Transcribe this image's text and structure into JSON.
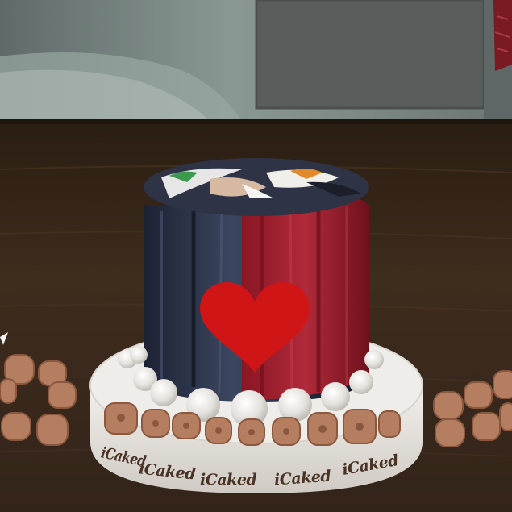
{
  "scene": {
    "subject": "virtual-world-cake",
    "brand_text": "iCaked",
    "brand_repeats": [
      "iCaked",
      "iCaked",
      "iCaked",
      "iCaked",
      "iCaked"
    ],
    "colors": {
      "wall": "#7d8a86",
      "window": "#595e5c",
      "table": "#3b2a1b",
      "heart": "#d01517",
      "board": "#ebe9e4",
      "cookie_letters": "#b57e60",
      "cake_dark": "#232838",
      "cake_red": "#9b1e2d"
    }
  }
}
